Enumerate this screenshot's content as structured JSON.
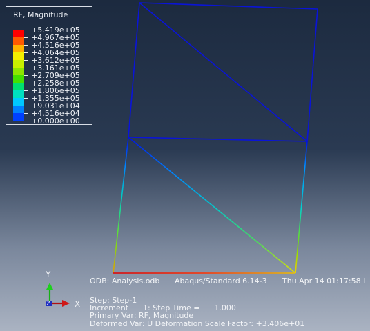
{
  "legend": {
    "title": "RF, Magnitude",
    "labels": [
      "+5.419e+05",
      "+4.967e+05",
      "+4.516e+05",
      "+4.064e+05",
      "+3.612e+05",
      "+3.161e+05",
      "+2.709e+05",
      "+2.258e+05",
      "+1.806e+05",
      "+1.355e+05",
      "+9.031e+04",
      "+4.516e+04",
      "+0.000e+00"
    ],
    "colors": [
      "#ff0000",
      "#ff5a00",
      "#ffb300",
      "#f5f000",
      "#c8f000",
      "#8fe600",
      "#46e000",
      "#00e070",
      "#00e0c0",
      "#00c8ff",
      "#0080ff",
      "#0040ff"
    ]
  },
  "odb_line": {
    "odb": "ODB: Analysis.odb",
    "solver": "Abaqus/Standard 6.14-3",
    "date": "Thu Apr 14 01:17:58 I"
  },
  "step_info": {
    "step": "Step: Step-1",
    "increment": "Increment      1: Step Time =      1.000",
    "primary_var": "Primary Var: RF, Magnitude",
    "deformed_var": "Deformed Var: U   Deformation Scale Factor: +3.406e+01"
  },
  "triad": {
    "x_label": "X",
    "y_label": "Y",
    "z_label": "Z"
  }
}
